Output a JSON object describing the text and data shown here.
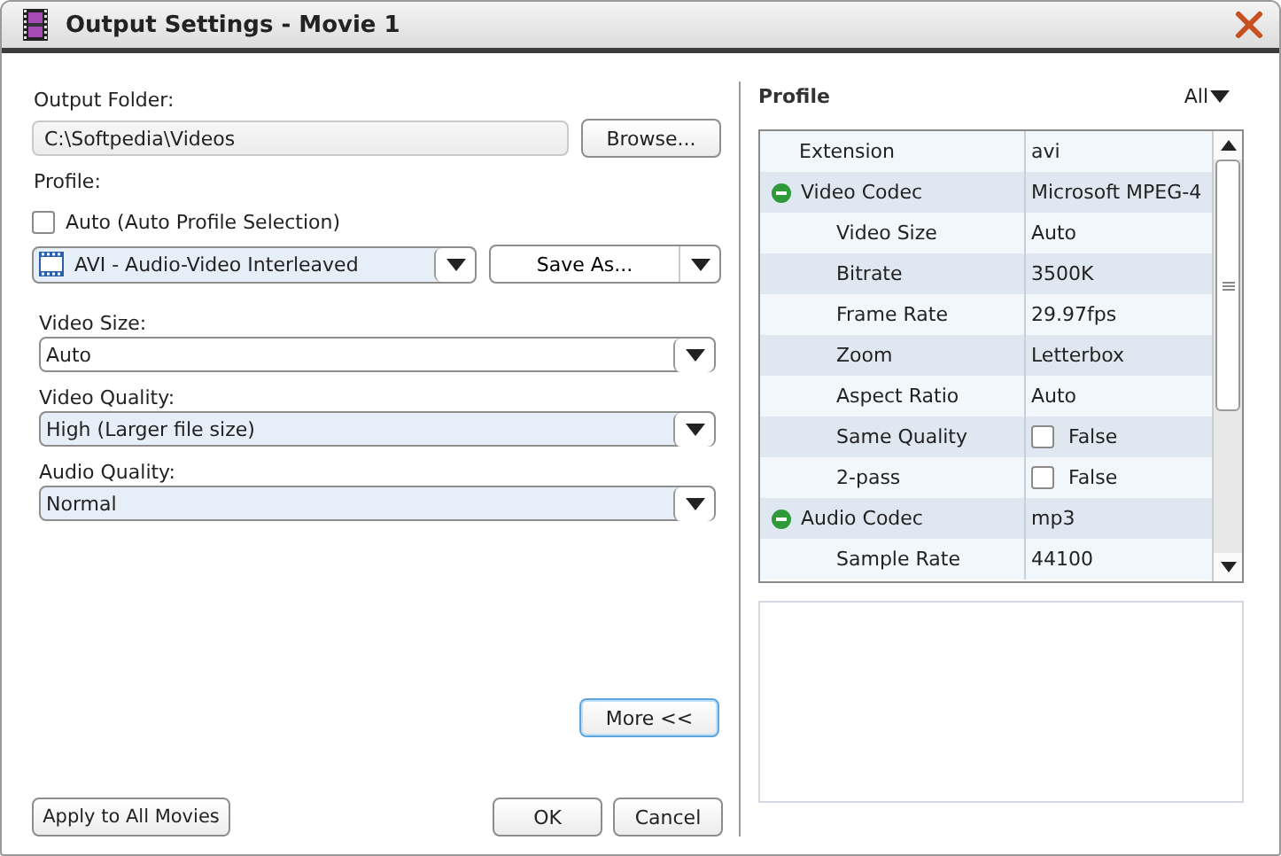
{
  "window": {
    "title": "Output Settings - Movie 1"
  },
  "left": {
    "output_folder_label": "Output Folder:",
    "output_folder": "C:\\Softpedia\\Videos",
    "browse_button": "Browse...",
    "profile_label": "Profile:",
    "auto_checkbox": {
      "label": "Auto (Auto Profile Selection)",
      "checked": false
    },
    "profile_combo": {
      "value": "AVI - Audio-Video Interleaved"
    },
    "save_as_button": "Save As...",
    "selects": [
      {
        "label": "Video Size:",
        "value": "Auto",
        "highlighted": false
      },
      {
        "label": "Video Quality:",
        "value": "High (Larger file size)",
        "highlighted": true
      },
      {
        "label": "Audio Quality:",
        "value": "Normal",
        "highlighted": true
      }
    ],
    "more_button": "More <<"
  },
  "right": {
    "title": "Profile",
    "filter": "All",
    "properties": [
      {
        "kind": "text",
        "name": "Extension",
        "value": "avi"
      },
      {
        "kind": "group",
        "name": "Video Codec",
        "value": "Microsoft MPEG-4",
        "expanded": true,
        "children": [
          {
            "kind": "text",
            "name": "Video Size",
            "value": "Auto"
          },
          {
            "kind": "text",
            "name": "Bitrate",
            "value": "3500K"
          },
          {
            "kind": "text",
            "name": "Frame Rate",
            "value": "29.97fps"
          },
          {
            "kind": "text",
            "name": "Zoom",
            "value": "Letterbox"
          },
          {
            "kind": "text",
            "name": "Aspect Ratio",
            "value": "Auto"
          },
          {
            "kind": "checkbox",
            "name": "Same Quality",
            "value": "False",
            "checked": false
          },
          {
            "kind": "checkbox",
            "name": "2-pass",
            "value": "False",
            "checked": false
          }
        ]
      },
      {
        "kind": "group",
        "name": "Audio Codec",
        "value": "mp3",
        "expanded": true,
        "children": [
          {
            "kind": "text",
            "name": "Sample Rate",
            "value": "44100"
          }
        ]
      }
    ]
  },
  "buttons": {
    "apply_all": "Apply to All Movies",
    "ok": "OK",
    "cancel": "Cancel"
  }
}
